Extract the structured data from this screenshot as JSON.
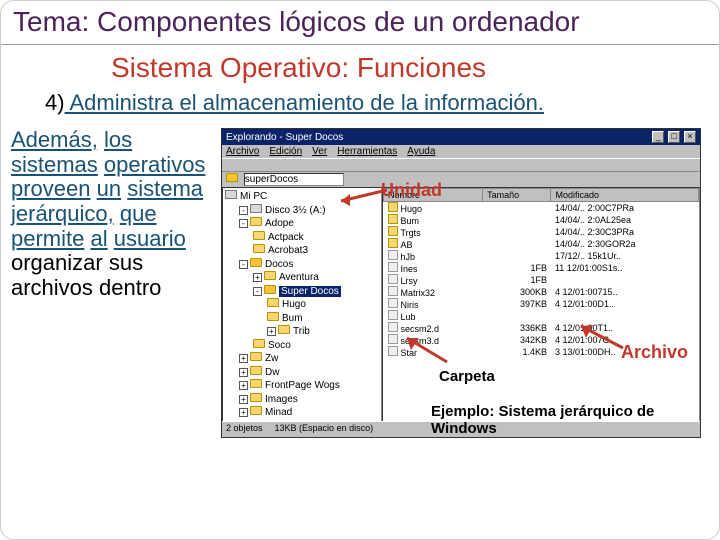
{
  "slide": {
    "tema": "Tema: Componentes lógicos de un ordenador",
    "sub": "Sistema Operativo: Funciones",
    "num": "4)",
    "numtext": "Administra el almacenamiento de la información.",
    "para_words": [
      "Además,",
      "los",
      "sistemas",
      "operativos",
      "proveen",
      "un",
      "sistema",
      "jerárquico,",
      "que",
      "permite",
      "al",
      "usuario"
    ],
    "para_tail": "organizar sus archivos dentro"
  },
  "explorer": {
    "title": "Explorando - Super Docos",
    "menu": [
      "Archivo",
      "Edición",
      "Ver",
      "Herramientas",
      "Ayuda"
    ],
    "addr_label": "superDocos",
    "tree": [
      {
        "ind": 0,
        "box": "",
        "icon": "drv",
        "label": "Mi PC"
      },
      {
        "ind": 1,
        "box": "-",
        "icon": "drv",
        "label": "Disco 3½ (A:)"
      },
      {
        "ind": 1,
        "box": "-",
        "icon": "fld",
        "label": "Adope"
      },
      {
        "ind": 2,
        "box": "",
        "icon": "fld",
        "label": "Actpack"
      },
      {
        "ind": 2,
        "box": "",
        "icon": "fld",
        "label": "Acrobat3"
      },
      {
        "ind": 1,
        "box": "-",
        "icon": "fld open",
        "label": "Docos"
      },
      {
        "ind": 2,
        "box": "+",
        "icon": "fld",
        "label": "Aventura"
      },
      {
        "ind": 2,
        "box": "-",
        "icon": "fld open",
        "label": "Super Docos",
        "sel": true
      },
      {
        "ind": 3,
        "box": "",
        "icon": "fld",
        "label": "Hugo"
      },
      {
        "ind": 3,
        "box": "",
        "icon": "fld",
        "label": "Bum"
      },
      {
        "ind": 3,
        "box": "+",
        "icon": "fld",
        "label": "Trib"
      },
      {
        "ind": 2,
        "box": "",
        "icon": "fld",
        "label": "Soco"
      },
      {
        "ind": 1,
        "box": "+",
        "icon": "fld",
        "label": "Zw"
      },
      {
        "ind": 1,
        "box": "+",
        "icon": "fld",
        "label": "Dw"
      },
      {
        "ind": 1,
        "box": "+",
        "icon": "fld",
        "label": "FrontPage Wogs"
      },
      {
        "ind": 1,
        "box": "+",
        "icon": "fld",
        "label": "Images"
      },
      {
        "ind": 1,
        "box": "+",
        "icon": "fld",
        "label": "Minad"
      }
    ],
    "columns": [
      "Nombre",
      "Tamaño",
      "Modificado"
    ],
    "files": [
      {
        "n": "Hugo",
        "t": "",
        "m": "14/04/.. 2:00C7PRa",
        "f": true
      },
      {
        "n": "Bum",
        "t": "",
        "m": "14/04/.. 2:0AL25ea",
        "f": true
      },
      {
        "n": "Trgts",
        "t": "",
        "m": "14/04/.. 2:30C3PRa",
        "f": true
      },
      {
        "n": "AB",
        "t": "",
        "m": "14/04/.. 2:30GOR2a",
        "f": true
      },
      {
        "n": "hJb",
        "t": "",
        "m": "17/12/.. 15k1Ur..",
        "f": false
      },
      {
        "n": "Ines",
        "t": "1FB",
        "m": "11 12/01:00S1s..",
        "f": false
      },
      {
        "n": "Lrsy",
        "t": "1FB",
        "m": "",
        "f": false
      },
      {
        "n": "Matrix32",
        "t": "300KB",
        "m": "4 12/01:00715..",
        "f": false
      },
      {
        "n": "Niris",
        "t": "397KB",
        "m": "4 12/01:00D1..",
        "f": false
      },
      {
        "n": "Lub",
        "t": "",
        "m": "",
        "f": false
      },
      {
        "n": "secsm2.d",
        "t": "336KB",
        "m": "4 12/01:00T1..",
        "f": false
      },
      {
        "n": "secsm3.d",
        "t": "342KB",
        "m": "4 12/01:007G..",
        "f": false
      },
      {
        "n": "Star",
        "t": "1.4KB",
        "m": "3 13/01:00DH..",
        "f": false
      }
    ],
    "status": [
      "2 objetos",
      "13KB (Espacio en disco)"
    ]
  },
  "annotations": {
    "unidad": "Unidad",
    "carpeta": "Carpeta",
    "archivo": "Archivo",
    "caption": "Ejemplo: Sistema jerárquico de Windows"
  }
}
